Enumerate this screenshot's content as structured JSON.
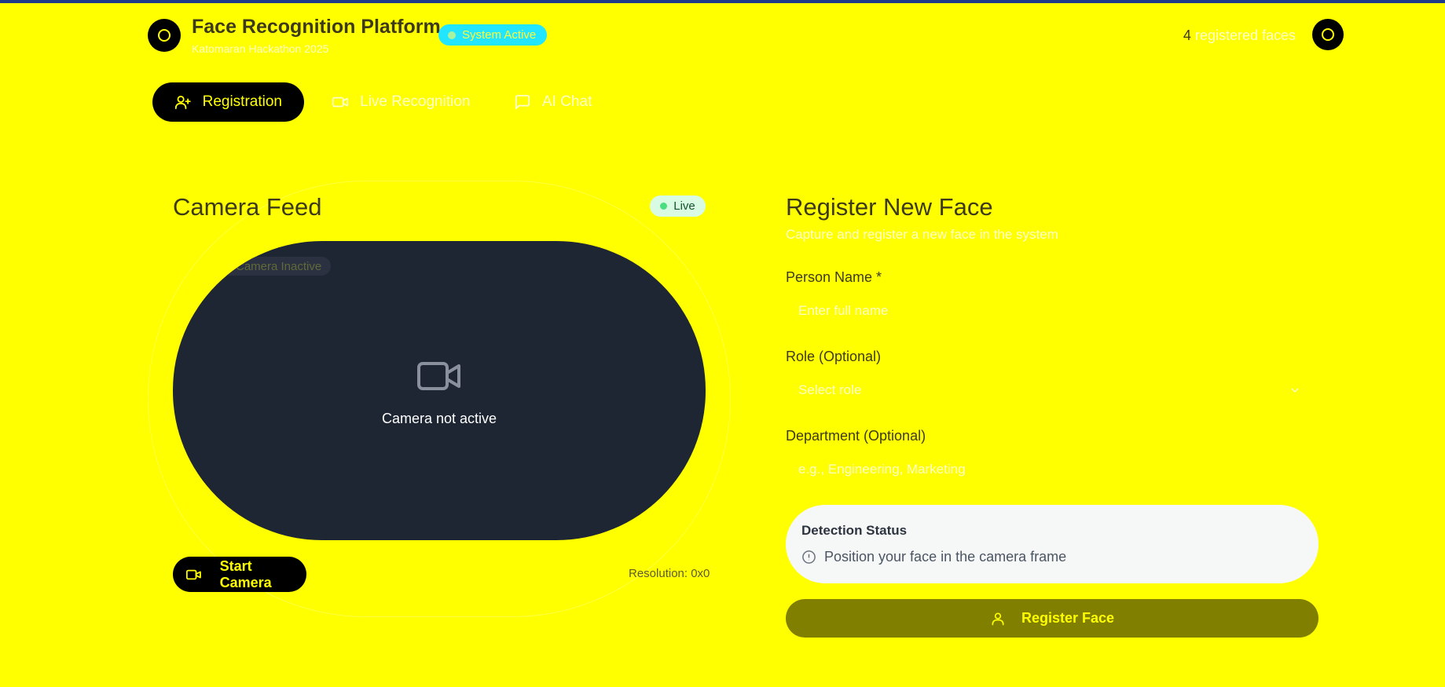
{
  "header": {
    "title": "Face Recognition Platform",
    "subtitle": "Katomaran Hackathon 2025",
    "status": "System Active",
    "registered_count": "4",
    "registered_suffix": " registered faces"
  },
  "tabs": [
    {
      "label": "Registration",
      "icon": "user-plus-icon",
      "active": true
    },
    {
      "label": "Live Recognition",
      "icon": "video-icon",
      "active": false
    },
    {
      "label": "AI Chat",
      "icon": "chat-bubble-icon",
      "active": false
    }
  ],
  "camera": {
    "title": "Camera Feed",
    "live_badge": "Live",
    "inactive_badge": "Camera Inactive",
    "message": "Camera not active",
    "start_button": "Start Camera",
    "resolution": "Resolution: 0x0"
  },
  "register": {
    "title": "Register New Face",
    "subtitle": "Capture and register a new face in the system",
    "name_label": "Person Name *",
    "name_placeholder": "Enter full name",
    "role_label": "Role (Optional)",
    "role_value": "Select role",
    "dept_label": "Department (Optional)",
    "dept_placeholder": "e.g., Engineering, Marketing",
    "detection_title": "Detection Status",
    "detection_message": "Position your face in the camera frame",
    "submit": "Register Face"
  },
  "colors": {
    "background": "#ffff00",
    "accent_dark": "#000000",
    "status_pill": "#22e6ff",
    "camera_bg": "#1e2634",
    "register_button": "#807f00"
  }
}
